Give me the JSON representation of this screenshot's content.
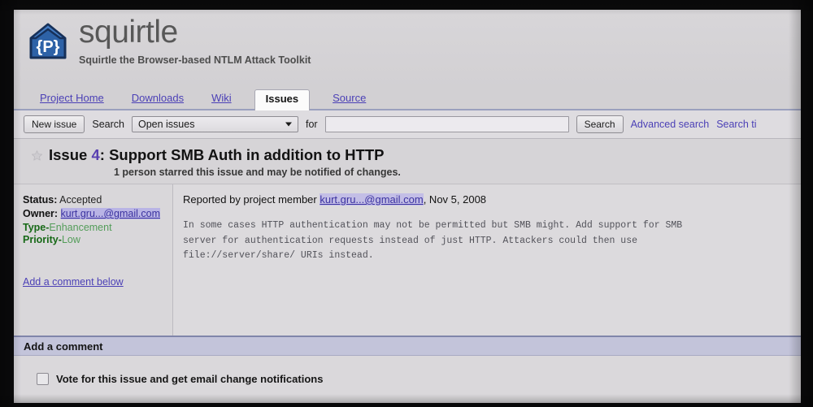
{
  "site": {
    "project_name": "squirtle",
    "tagline": "Squirtle the Browser-based NTLM Attack Toolkit",
    "logo_glyph": "{P}"
  },
  "nav": {
    "tabs": [
      {
        "label": "Project Home",
        "active": false
      },
      {
        "label": "Downloads",
        "active": false
      },
      {
        "label": "Wiki",
        "active": false
      },
      {
        "label": "Issues",
        "active": true
      },
      {
        "label": "Source",
        "active": false
      }
    ]
  },
  "toolbar": {
    "new_issue_label": "New issue",
    "search_label": "Search",
    "scope_value": "Open issues",
    "for_label": "for",
    "query_value": "",
    "query_placeholder": "",
    "search_button_label": "Search",
    "advanced_search_label": "Advanced search",
    "search_tips_label": "Search ti"
  },
  "issue": {
    "prefix": "Issue ",
    "number": "4",
    "separator": ": ",
    "title": "Support SMB Auth in addition to HTTP",
    "starred_note": "1 person starred this issue and may be notified of changes.",
    "star_icon": "star-outline-icon"
  },
  "meta": {
    "status_key": "Status:",
    "status_value": "Accepted",
    "owner_key": "Owner:",
    "owner_value": "kurt.gru...@gmail.com",
    "type_key": "Type-",
    "type_value": "Enhancement",
    "priority_key": "Priority-",
    "priority_value": "Low",
    "add_comment_link": "Add a comment below"
  },
  "detail": {
    "reported_prefix": "Reported by project member ",
    "reported_author": "kurt.gru...@gmail.com",
    "reported_suffix": ", Nov 5, 2008",
    "description": "In some cases HTTP authentication may not be permitted but SMB might. Add support for SMB\nserver for authentication requests instead of just HTTP. Attackers could then use\nfile://server/share/ URIs instead."
  },
  "comment_section": {
    "header": "Add a comment",
    "vote_label": "Vote for this issue and get email change notifications",
    "vote_checked": false
  },
  "colors": {
    "link": "#4b3fbe",
    "link_visited": "#5a3fb8",
    "label_green": "#136b13",
    "label_green_light": "#4f9e55",
    "page_bg": "#d5d3d6",
    "tab_active_bg": "#fbfbfb",
    "comment_bar_bg": "#c3c4dc",
    "logo_blue": "#2a62ad"
  }
}
